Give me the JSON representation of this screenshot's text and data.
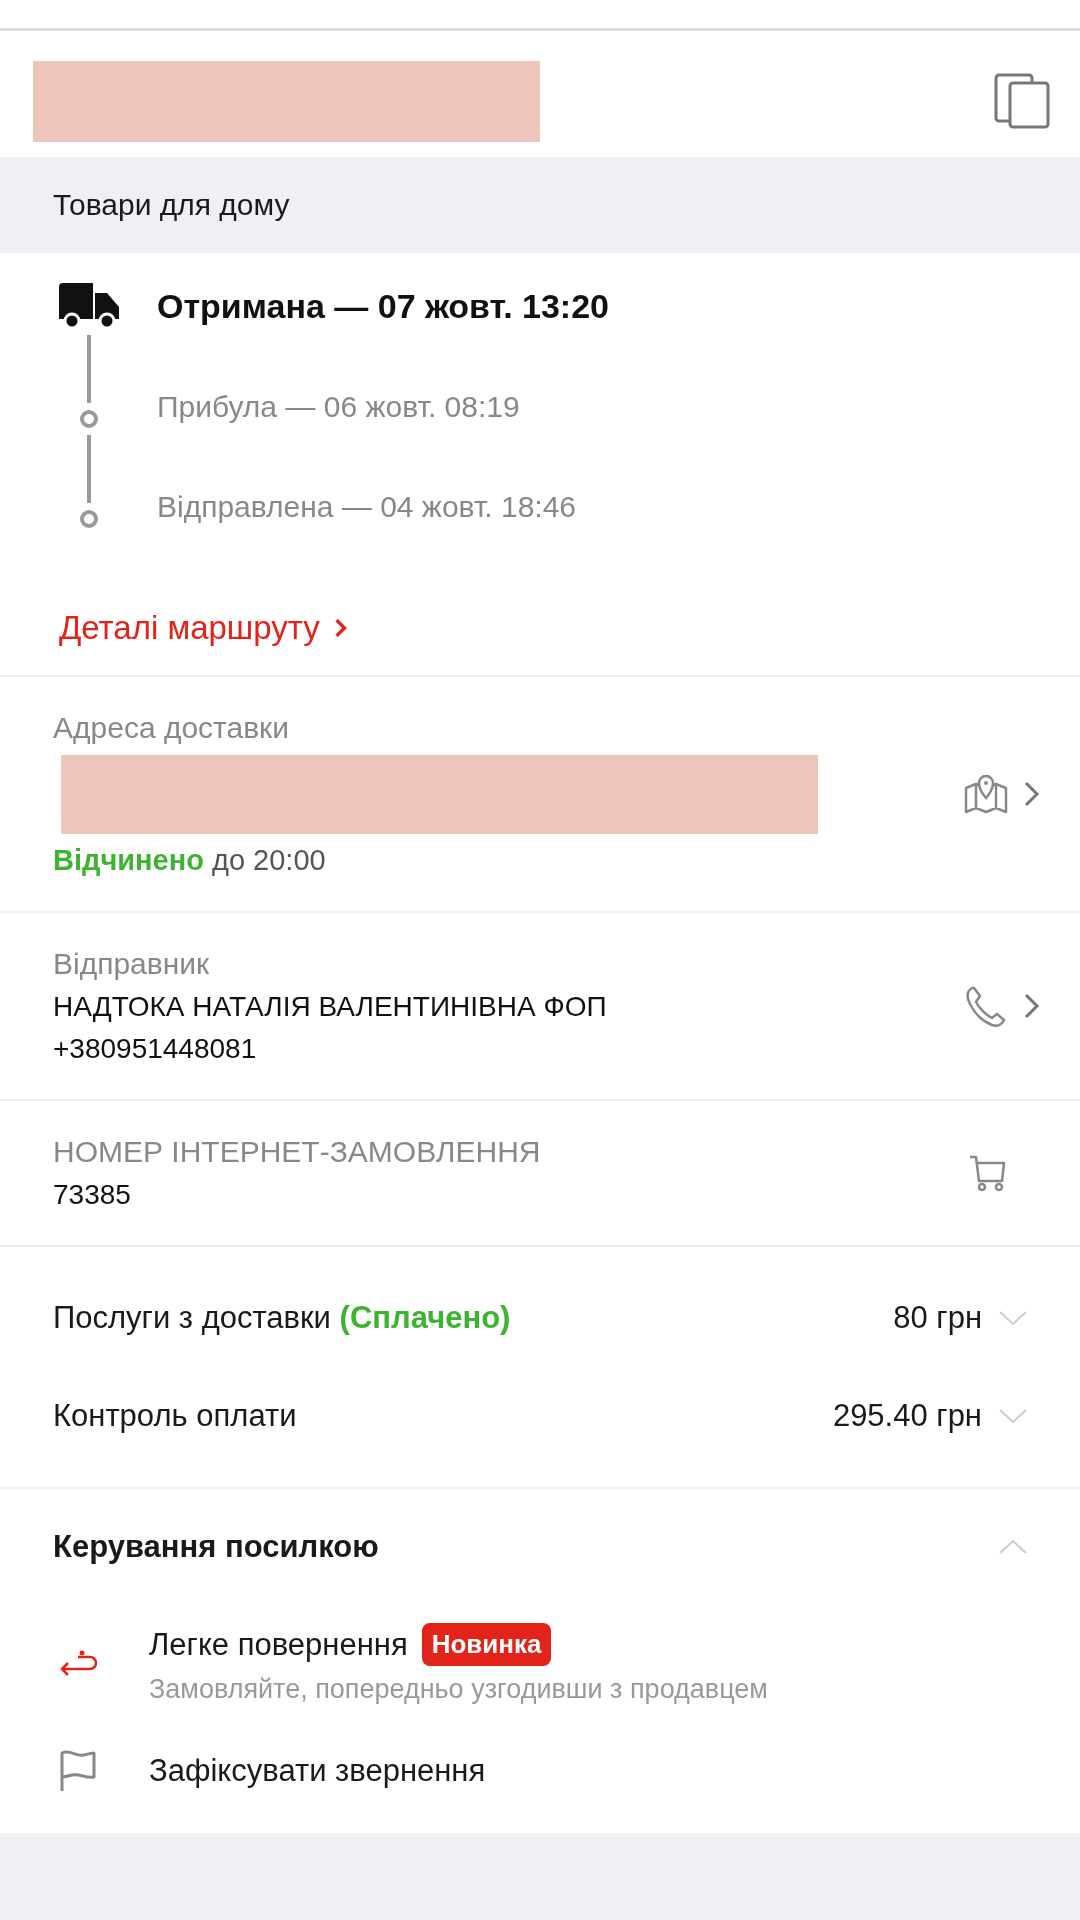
{
  "category": "Товари для дому",
  "tracking": [
    {
      "kind": "current",
      "text": "Отримана — 07 жовт. 13:20"
    },
    {
      "kind": "past",
      "text": "Прибула — 06 жовт. 08:19"
    },
    {
      "kind": "past",
      "text": "Відправлена — 04 жовт. 18:46"
    }
  ],
  "route_link": "Деталі маршруту",
  "address": {
    "label": "Адреса доставки",
    "hours": {
      "open": true,
      "status": "Відчинено",
      "until": "до 20:00"
    }
  },
  "sender": {
    "label": "Відправник",
    "name": "НАДТОКА НАТАЛІЯ ВАЛЕНТИНІВНА ФОП",
    "phone": "+380951448081"
  },
  "order": {
    "label": "НОМЕР ІНТЕРНЕТ-ЗАМОВЛЕННЯ",
    "number": "73385"
  },
  "fees": [
    {
      "label": "Послуги з доставки",
      "note": "(Сплачено)",
      "amount": "80 грн",
      "expanded": false
    },
    {
      "label": "Контроль оплати",
      "amount": "295.40 грн",
      "expanded": false
    }
  ],
  "manage": {
    "title": "Керування посилкою",
    "expanded": true,
    "actions": [
      {
        "kind": "return",
        "title": "Легке повернення",
        "badge": "Новинка",
        "subtitle": "Замовляйте, попередньо узгодивши з продавцем"
      },
      {
        "kind": "report",
        "title": "Зафіксувати звернення"
      }
    ]
  }
}
